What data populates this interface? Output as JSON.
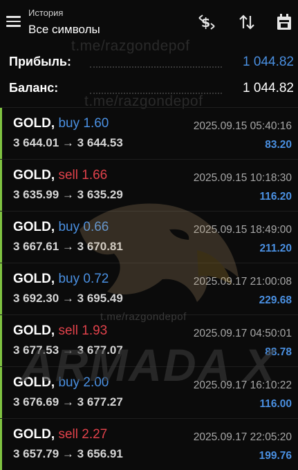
{
  "header": {
    "subtitle": "История",
    "title": "Все символы"
  },
  "summary": {
    "profit_label": "Прибыль:",
    "profit_value": "1 044.82",
    "balance_label": "Баланс:",
    "balance_value": "1 044.82"
  },
  "watermark": {
    "channel": "t.me/razgondepof",
    "logo_text": "ARMADA X"
  },
  "trades": [
    {
      "symbol": "GOLD,",
      "side": "buy",
      "volume": "1.60",
      "open": "3 644.01",
      "close": "3 644.53",
      "time": "2025.09.15 05:40:16",
      "profit": "83.20"
    },
    {
      "symbol": "GOLD,",
      "side": "sell",
      "volume": "1.66",
      "open": "3 635.99",
      "close": "3 635.29",
      "time": "2025.09.15 10:18:30",
      "profit": "116.20"
    },
    {
      "symbol": "GOLD,",
      "side": "buy",
      "volume": "0.66",
      "open": "3 667.61",
      "close": "3 670.81",
      "time": "2025.09.15 18:49:00",
      "profit": "211.20"
    },
    {
      "symbol": "GOLD,",
      "side": "buy",
      "volume": "0.72",
      "open": "3 692.30",
      "close": "3 695.49",
      "time": "2025.09.17 21:00:08",
      "profit": "229.68"
    },
    {
      "symbol": "GOLD,",
      "side": "sell",
      "volume": "1.93",
      "open": "3 677.53",
      "close": "3 677.07",
      "time": "2025.09.17 04:50:01",
      "profit": "88.78"
    },
    {
      "symbol": "GOLD,",
      "side": "buy",
      "volume": "2.00",
      "open": "3 676.69",
      "close": "3 677.27",
      "time": "2025.09.17 16:10:22",
      "profit": "116.00"
    },
    {
      "symbol": "GOLD,",
      "side": "sell",
      "volume": "2.27",
      "open": "3 657.79",
      "close": "3 656.91",
      "time": "2025.09.17 22:05:20",
      "profit": "199.76"
    }
  ],
  "arrow_glyph": "→",
  "colors": {
    "buy": "#4a90e2",
    "sell": "#e2424b",
    "profit": "#4a90e2",
    "row_marker": "#7fc241",
    "background": "#0b0b0b"
  },
  "icons": {
    "menu": "hamburger-menu-icon",
    "currency": "currency-sort-icon",
    "sort": "sort-arrows-icon",
    "calendar": "calendar-icon"
  }
}
